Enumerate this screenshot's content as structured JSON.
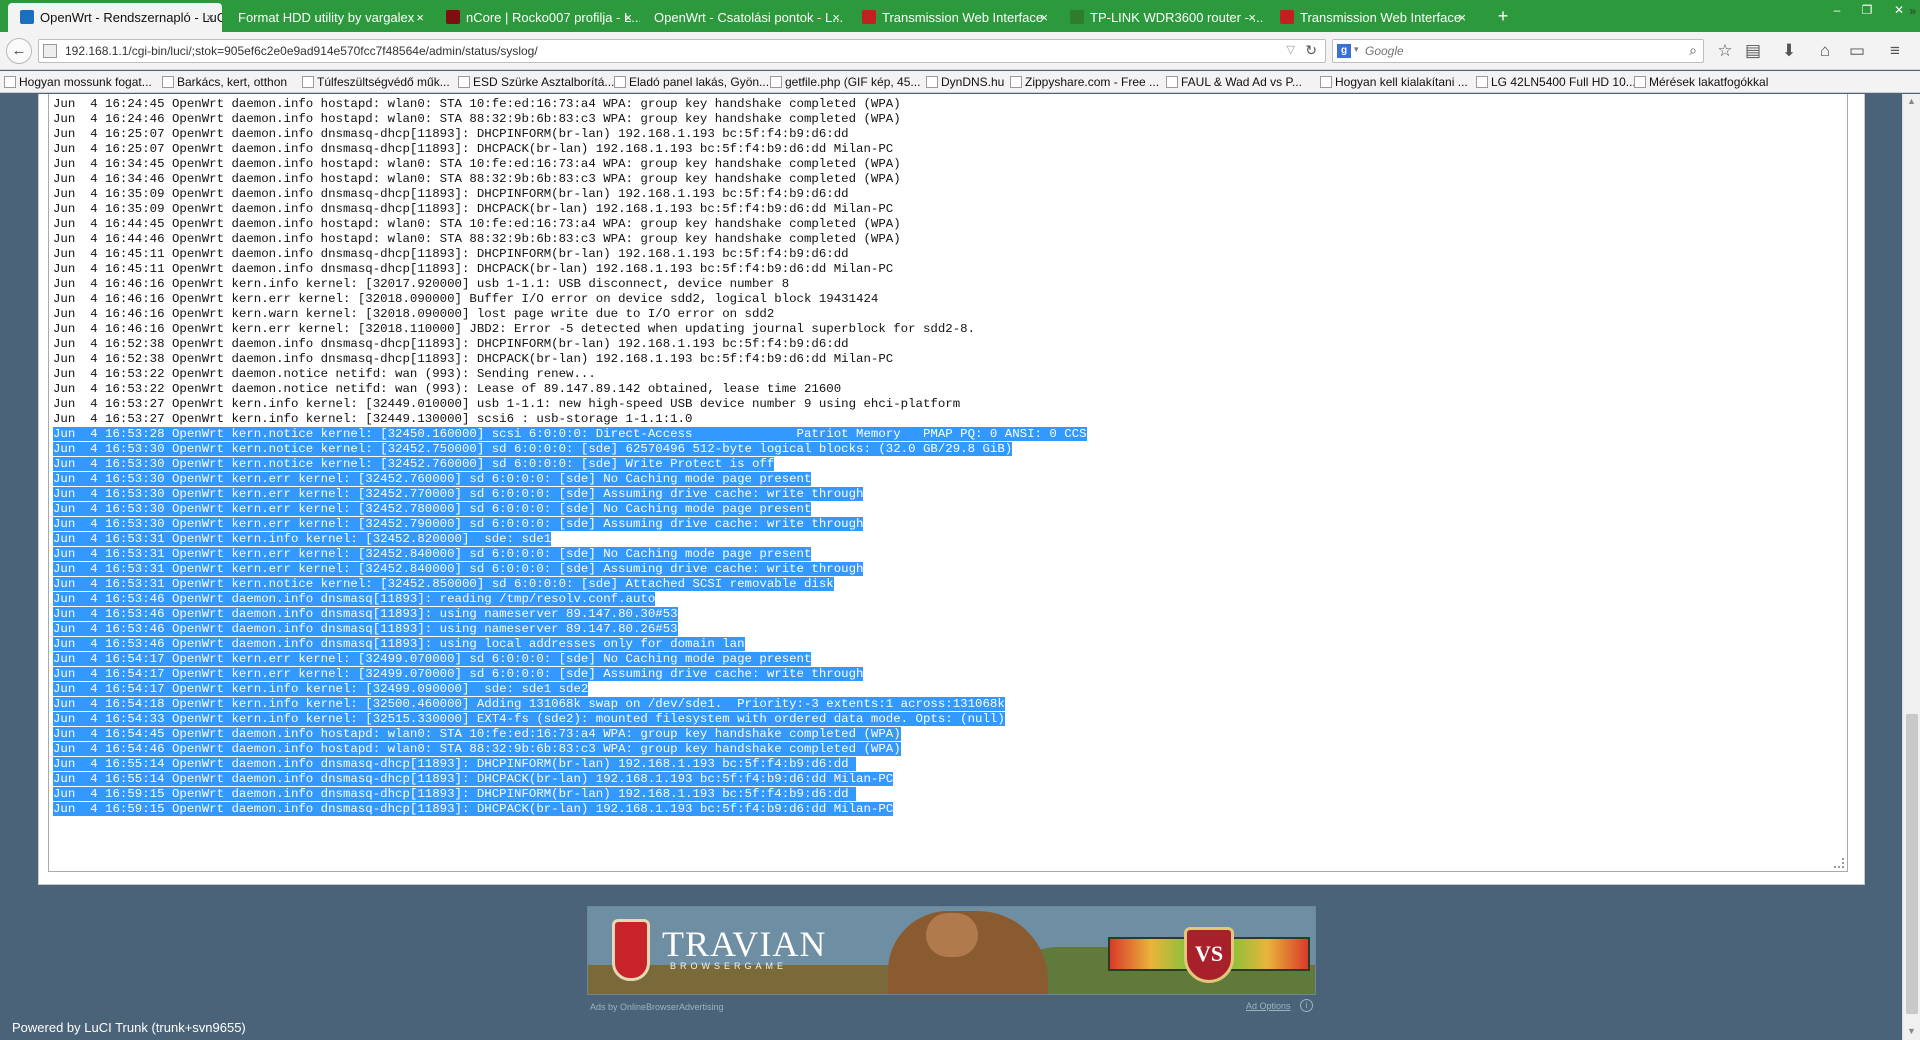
{
  "tabs": [
    {
      "title": "OpenWrt - Rendszernapló - LuCI",
      "active": true,
      "icon": "openwrt-favicon"
    },
    {
      "title": "Format HDD utility by vargalex",
      "active": false,
      "icon": "none"
    },
    {
      "title": "nCore | Rocko007 profilja - L...",
      "active": false,
      "icon": "ncore-favicon"
    },
    {
      "title": "OpenWrt - Csatolási pontok - L...",
      "active": false,
      "icon": "none"
    },
    {
      "title": "Transmission Web Interface",
      "active": false,
      "icon": "transmission-favicon"
    },
    {
      "title": "TP-LINK WDR3600 router - ...",
      "active": false,
      "icon": "tplink-favicon"
    },
    {
      "title": "Transmission Web Interface",
      "active": false,
      "icon": "transmission-favicon"
    }
  ],
  "new_tab_label": "+",
  "window_controls": {
    "minimize": "–",
    "maximize": "❐",
    "close": "✕"
  },
  "nav": {
    "url": "192.168.1.1/cgi-bin/luci/;stok=905ef6c2e0e9ad914e570fcc7f48564e/admin/status/syslog/",
    "search_placeholder": "Google"
  },
  "bookmarks": [
    "Hogyan mossunk fogat...",
    "Barkács, kert, otthon",
    "Túlfeszültségvédő műk...",
    "ESD Szürke Asztalborítá...",
    "Eladó panel lakás, Gyön...",
    "getfile.php (GIF kép, 45...",
    "DynDNS.hu",
    "Zippyshare.com - Free ...",
    "FAUL & Wad Ad vs P...",
    "Hogyan kell kialakítani ...",
    "LG 42LN5400 Full HD 10...",
    "Mérések lakatfogókkal"
  ],
  "bookmarks_more": "»",
  "log": [
    {
      "text": "Jun  4 16:24:45 OpenWrt daemon.info hostapd: wlan0: STA 10:fe:ed:16:73:a4 WPA: group key handshake completed (WPA)",
      "selected": false
    },
    {
      "text": "Jun  4 16:24:46 OpenWrt daemon.info hostapd: wlan0: STA 88:32:9b:6b:83:c3 WPA: group key handshake completed (WPA)",
      "selected": false
    },
    {
      "text": "Jun  4 16:25:07 OpenWrt daemon.info dnsmasq-dhcp[11893]: DHCPINFORM(br-lan) 192.168.1.193 bc:5f:f4:b9:d6:dd",
      "selected": false
    },
    {
      "text": "Jun  4 16:25:07 OpenWrt daemon.info dnsmasq-dhcp[11893]: DHCPACK(br-lan) 192.168.1.193 bc:5f:f4:b9:d6:dd Milan-PC",
      "selected": false
    },
    {
      "text": "Jun  4 16:34:45 OpenWrt daemon.info hostapd: wlan0: STA 10:fe:ed:16:73:a4 WPA: group key handshake completed (WPA)",
      "selected": false
    },
    {
      "text": "Jun  4 16:34:46 OpenWrt daemon.info hostapd: wlan0: STA 88:32:9b:6b:83:c3 WPA: group key handshake completed (WPA)",
      "selected": false
    },
    {
      "text": "Jun  4 16:35:09 OpenWrt daemon.info dnsmasq-dhcp[11893]: DHCPINFORM(br-lan) 192.168.1.193 bc:5f:f4:b9:d6:dd",
      "selected": false
    },
    {
      "text": "Jun  4 16:35:09 OpenWrt daemon.info dnsmasq-dhcp[11893]: DHCPACK(br-lan) 192.168.1.193 bc:5f:f4:b9:d6:dd Milan-PC",
      "selected": false
    },
    {
      "text": "Jun  4 16:44:45 OpenWrt daemon.info hostapd: wlan0: STA 10:fe:ed:16:73:a4 WPA: group key handshake completed (WPA)",
      "selected": false
    },
    {
      "text": "Jun  4 16:44:46 OpenWrt daemon.info hostapd: wlan0: STA 88:32:9b:6b:83:c3 WPA: group key handshake completed (WPA)",
      "selected": false
    },
    {
      "text": "Jun  4 16:45:11 OpenWrt daemon.info dnsmasq-dhcp[11893]: DHCPINFORM(br-lan) 192.168.1.193 bc:5f:f4:b9:d6:dd",
      "selected": false
    },
    {
      "text": "Jun  4 16:45:11 OpenWrt daemon.info dnsmasq-dhcp[11893]: DHCPACK(br-lan) 192.168.1.193 bc:5f:f4:b9:d6:dd Milan-PC",
      "selected": false
    },
    {
      "text": "Jun  4 16:46:16 OpenWrt kern.info kernel: [32017.920000] usb 1-1.1: USB disconnect, device number 8",
      "selected": false
    },
    {
      "text": "Jun  4 16:46:16 OpenWrt kern.err kernel: [32018.090000] Buffer I/O error on device sdd2, logical block 19431424",
      "selected": false
    },
    {
      "text": "Jun  4 16:46:16 OpenWrt kern.warn kernel: [32018.090000] lost page write due to I/O error on sdd2",
      "selected": false
    },
    {
      "text": "Jun  4 16:46:16 OpenWrt kern.err kernel: [32018.110000] JBD2: Error -5 detected when updating journal superblock for sdd2-8.",
      "selected": false
    },
    {
      "text": "Jun  4 16:52:38 OpenWrt daemon.info dnsmasq-dhcp[11893]: DHCPINFORM(br-lan) 192.168.1.193 bc:5f:f4:b9:d6:dd",
      "selected": false
    },
    {
      "text": "Jun  4 16:52:38 OpenWrt daemon.info dnsmasq-dhcp[11893]: DHCPACK(br-lan) 192.168.1.193 bc:5f:f4:b9:d6:dd Milan-PC",
      "selected": false
    },
    {
      "text": "Jun  4 16:53:22 OpenWrt daemon.notice netifd: wan (993): Sending renew...",
      "selected": false
    },
    {
      "text": "Jun  4 16:53:22 OpenWrt daemon.notice netifd: wan (993): Lease of 89.147.89.142 obtained, lease time 21600",
      "selected": false
    },
    {
      "text": "Jun  4 16:53:27 OpenWrt kern.info kernel: [32449.010000] usb 1-1.1: new high-speed USB device number 9 using ehci-platform",
      "selected": false
    },
    {
      "text": "Jun  4 16:53:27 OpenWrt kern.info kernel: [32449.130000] scsi6 : usb-storage 1-1.1:1.0",
      "selected": false
    },
    {
      "text": "Jun  4 16:53:28 OpenWrt kern.notice kernel: [32450.160000] scsi 6:0:0:0: Direct-Access              Patriot Memory   PMAP PQ: 0 ANSI: 0 CCS",
      "selected": true
    },
    {
      "text": "Jun  4 16:53:30 OpenWrt kern.notice kernel: [32452.750000] sd 6:0:0:0: [sde] 62570496 512-byte logical blocks: (32.0 GB/29.8 GiB)",
      "selected": true
    },
    {
      "text": "Jun  4 16:53:30 OpenWrt kern.notice kernel: [32452.760000] sd 6:0:0:0: [sde] Write Protect is off",
      "selected": true
    },
    {
      "text": "Jun  4 16:53:30 OpenWrt kern.err kernel: [32452.760000] sd 6:0:0:0: [sde] No Caching mode page present",
      "selected": true
    },
    {
      "text": "Jun  4 16:53:30 OpenWrt kern.err kernel: [32452.770000] sd 6:0:0:0: [sde] Assuming drive cache: write through",
      "selected": true
    },
    {
      "text": "Jun  4 16:53:30 OpenWrt kern.err kernel: [32452.780000] sd 6:0:0:0: [sde] No Caching mode page present",
      "selected": true
    },
    {
      "text": "Jun  4 16:53:30 OpenWrt kern.err kernel: [32452.790000] sd 6:0:0:0: [sde] Assuming drive cache: write through",
      "selected": true
    },
    {
      "text": "Jun  4 16:53:31 OpenWrt kern.info kernel: [32452.820000]  sde: sde1",
      "selected": true
    },
    {
      "text": "Jun  4 16:53:31 OpenWrt kern.err kernel: [32452.840000] sd 6:0:0:0: [sde] No Caching mode page present",
      "selected": true
    },
    {
      "text": "Jun  4 16:53:31 OpenWrt kern.err kernel: [32452.840000] sd 6:0:0:0: [sde] Assuming drive cache: write through",
      "selected": true
    },
    {
      "text": "Jun  4 16:53:31 OpenWrt kern.notice kernel: [32452.850000] sd 6:0:0:0: [sde] Attached SCSI removable disk",
      "selected": true
    },
    {
      "text": "Jun  4 16:53:46 OpenWrt daemon.info dnsmasq[11893]: reading /tmp/resolv.conf.auto",
      "selected": true
    },
    {
      "text": "Jun  4 16:53:46 OpenWrt daemon.info dnsmasq[11893]: using nameserver 89.147.80.30#53",
      "selected": true
    },
    {
      "text": "Jun  4 16:53:46 OpenWrt daemon.info dnsmasq[11893]: using nameserver 89.147.80.26#53",
      "selected": true
    },
    {
      "text": "Jun  4 16:53:46 OpenWrt daemon.info dnsmasq[11893]: using local addresses only for domain lan",
      "selected": true
    },
    {
      "text": "Jun  4 16:54:17 OpenWrt kern.err kernel: [32499.070000] sd 6:0:0:0: [sde] No Caching mode page present",
      "selected": true
    },
    {
      "text": "Jun  4 16:54:17 OpenWrt kern.err kernel: [32499.070000] sd 6:0:0:0: [sde] Assuming drive cache: write through",
      "selected": true
    },
    {
      "text": "Jun  4 16:54:17 OpenWrt kern.info kernel: [32499.090000]  sde: sde1 sde2",
      "selected": true
    },
    {
      "text": "Jun  4 16:54:18 OpenWrt kern.info kernel: [32500.460000] Adding 131068k swap on /dev/sde1.  Priority:-3 extents:1 across:131068k",
      "selected": true
    },
    {
      "text": "Jun  4 16:54:33 OpenWrt kern.info kernel: [32515.330000] EXT4-fs (sde2): mounted filesystem with ordered data mode. Opts: (null)",
      "selected": true
    },
    {
      "text": "Jun  4 16:54:45 OpenWrt daemon.info hostapd: wlan0: STA 10:fe:ed:16:73:a4 WPA: group key handshake completed (WPA)",
      "selected": true
    },
    {
      "text": "Jun  4 16:54:46 OpenWrt daemon.info hostapd: wlan0: STA 88:32:9b:6b:83:c3 WPA: group key handshake completed (WPA)",
      "selected": true
    },
    {
      "text": "Jun  4 16:55:14 OpenWrt daemon.info dnsmasq-dhcp[11893]: DHCPINFORM(br-lan) 192.168.1.193 bc:5f:f4:b9:d6:dd ",
      "selected": true
    },
    {
      "text": "Jun  4 16:55:14 OpenWrt daemon.info dnsmasq-dhcp[11893]: DHCPACK(br-lan) 192.168.1.193 bc:5f:f4:b9:d6:dd Milan-PC",
      "selected": true
    },
    {
      "text": "Jun  4 16:59:15 OpenWrt daemon.info dnsmasq-dhcp[11893]: DHCPINFORM(br-lan) 192.168.1.193 bc:5f:f4:b9:d6:dd ",
      "selected": true
    },
    {
      "text": "Jun  4 16:59:15 OpenWrt daemon.info dnsmasq-dhcp[11893]: DHCPACK(br-lan) 192.168.1.193 bc:5f:f4:b9:d6:dd Milan-PC",
      "selected": true
    }
  ],
  "ad": {
    "title": "TRAVIAN",
    "subtitle": "BROWSERGAME",
    "vs": "VS",
    "by": "Ads by OnlineBrowserAdvertising",
    "options": "Ad Options",
    "info": "i"
  },
  "footer": "Powered by LuCI Trunk (trunk+svn9655)",
  "colors": {
    "tabbar": "#2c9a3c",
    "selection": "#3399ff",
    "page_bg": "#4a6378"
  }
}
